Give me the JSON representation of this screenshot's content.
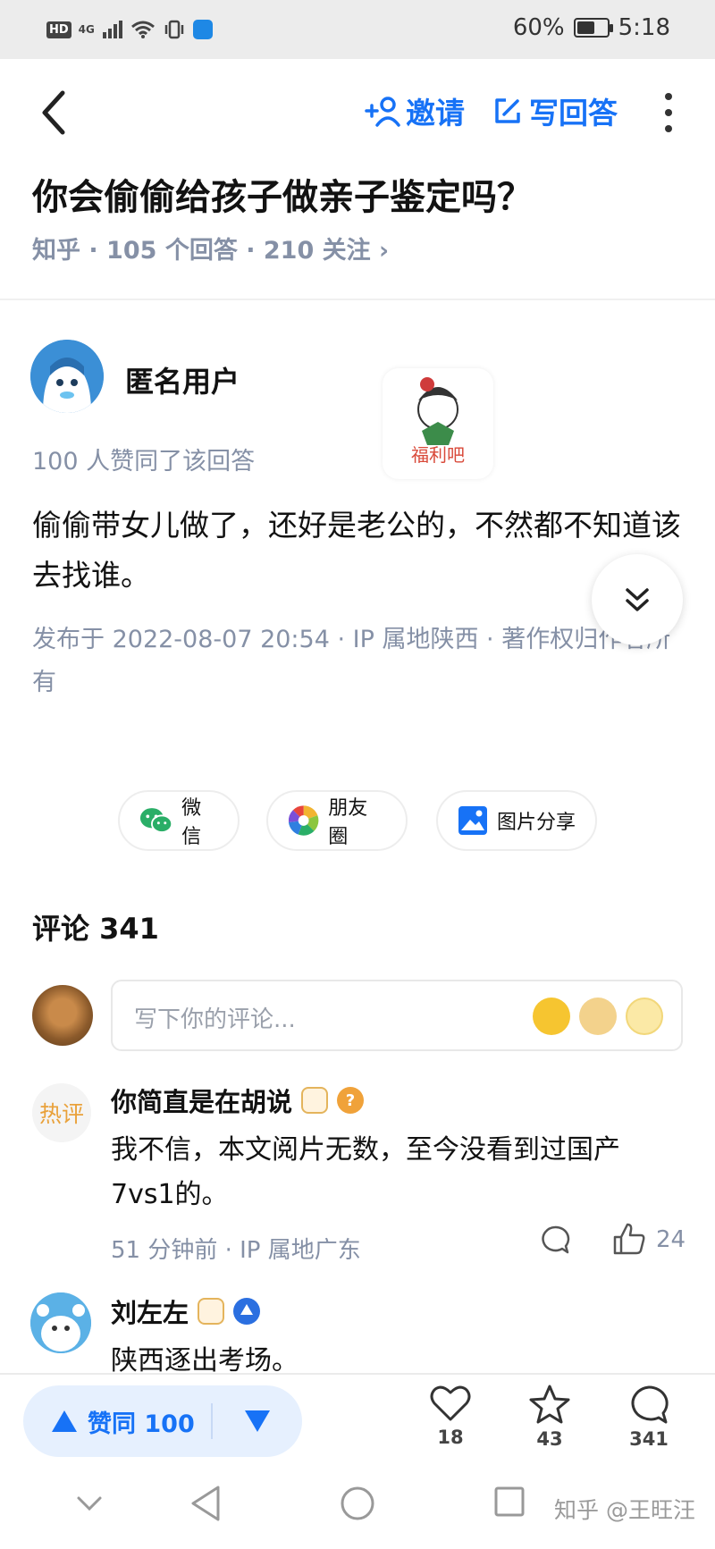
{
  "status_bar": {
    "hd": "HD",
    "network": "4G",
    "battery": "60%",
    "battery_level": 0.6,
    "time": "5:18"
  },
  "nav": {
    "invite_label": "邀请",
    "write_label": "写回答"
  },
  "question": {
    "title": "你会偷偷给孩子做亲子鉴定吗？",
    "meta": "知乎 · 105 个回答 · 210 关注 ›"
  },
  "answer": {
    "author": "匿名用户",
    "votes_line": "100 人赞同了该回答",
    "text": "偷偷带女儿做了，还好是老公的，不然都不知道该去找谁。",
    "pub_info": "发布于 2022-08-07 20:54 · IP 属地陕西 · 著作权归作者所有"
  },
  "watermark": {
    "text": "福利吧"
  },
  "share": {
    "wechat": "微信",
    "moments": "朋友圈",
    "image": "图片分享"
  },
  "comments": {
    "header": "评论 341",
    "input_placeholder": "写下你的评论...",
    "items": [
      {
        "badge": "热评",
        "name": "你简直是在胡说",
        "text": "我不信，本文阅片无数，至今没看到过国产7vs1的。",
        "meta": "51 分钟前 · IP 属地广东",
        "likes": "24"
      },
      {
        "name": "刘左左",
        "text": "陕西逐出考场。"
      }
    ]
  },
  "bottom_bar": {
    "vote_label": "赞同 100",
    "like_count": "18",
    "favorite_count": "43",
    "comment_count": "341"
  },
  "system_nav": {
    "credit": "知乎 @王旺汪"
  },
  "colors": {
    "accent": "#1772f6",
    "muted": "#8590a6",
    "hot": "#e9a13a"
  }
}
